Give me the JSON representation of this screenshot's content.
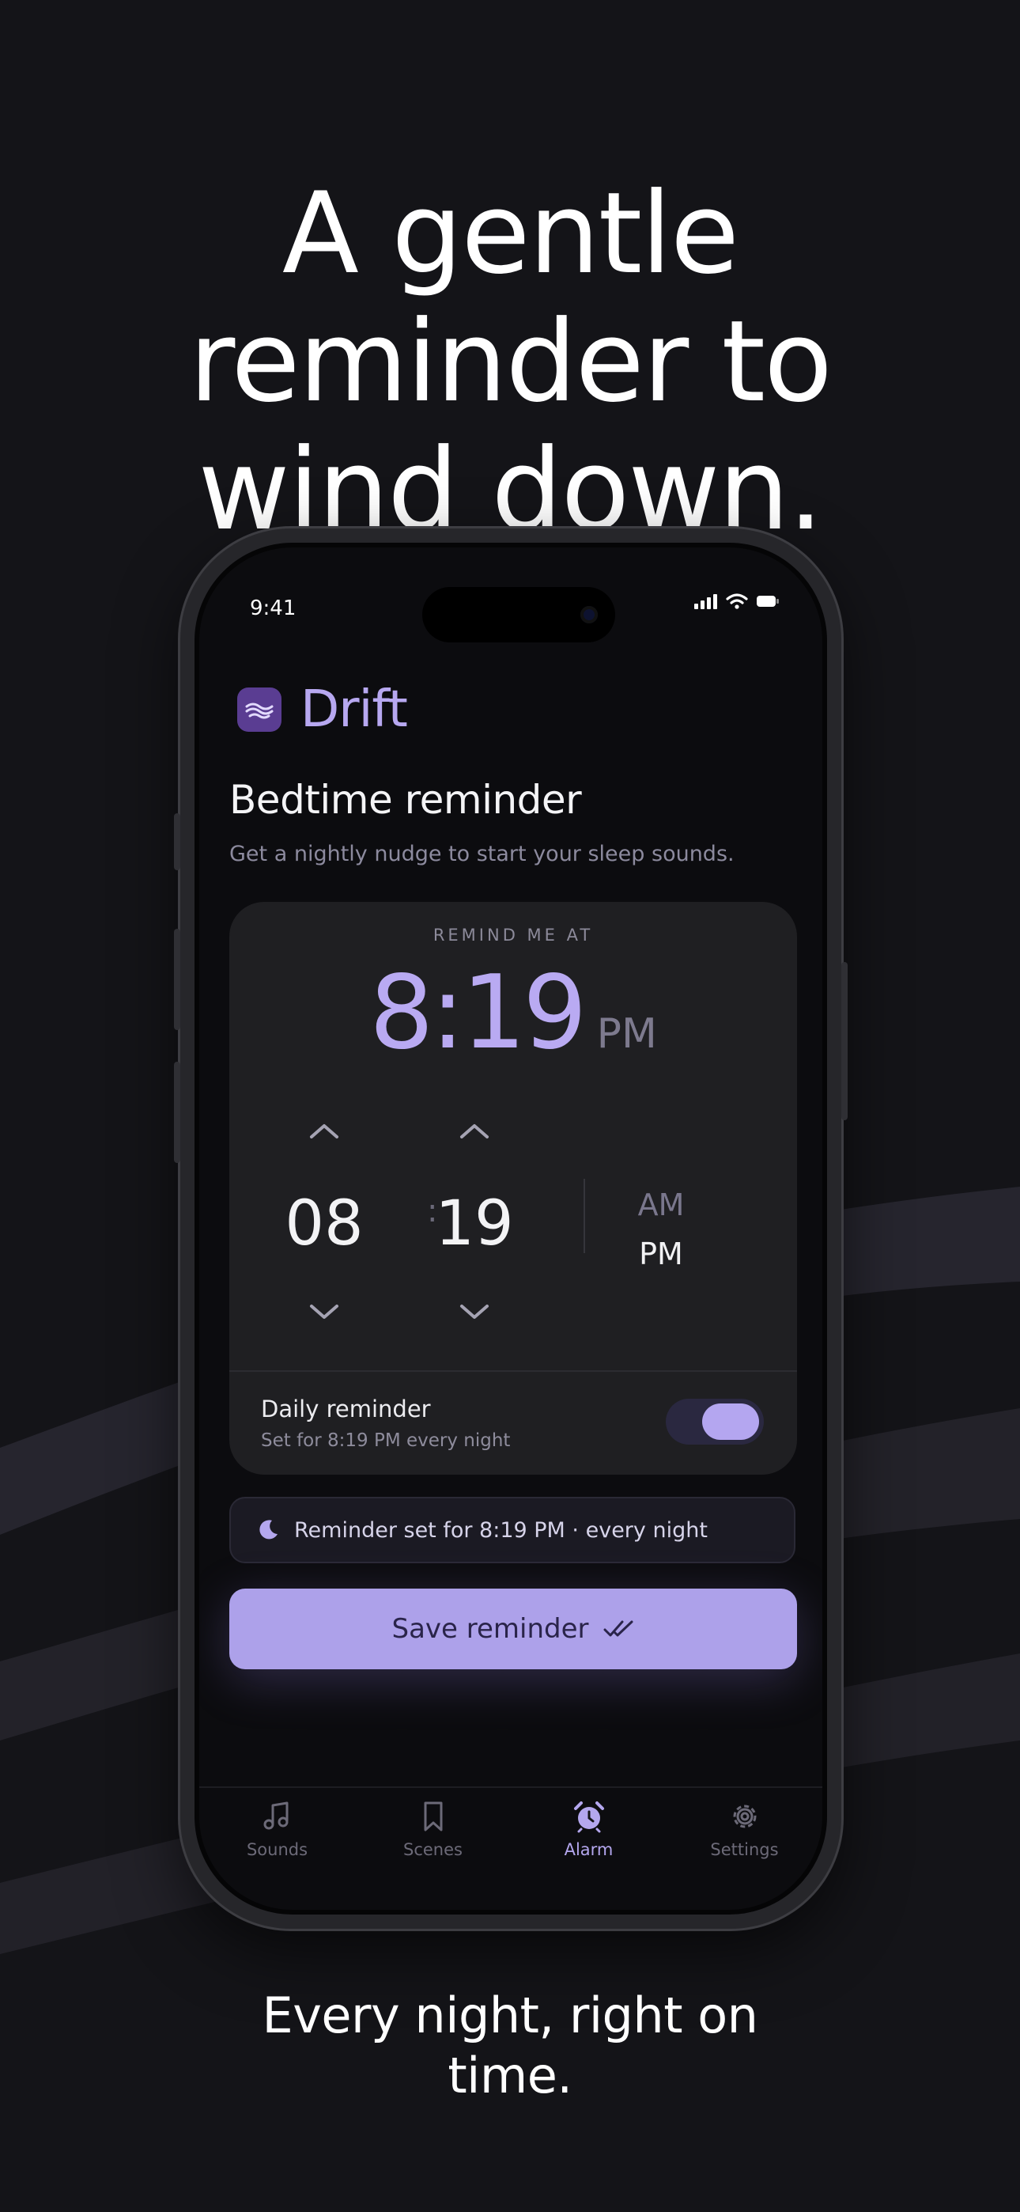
{
  "marketing": {
    "headline_lines": [
      "A gentle",
      "reminder to",
      "wind down."
    ],
    "caption_lines": [
      "Every night, right on",
      "time."
    ]
  },
  "status_bar": {
    "time": "9:41"
  },
  "app": {
    "name": "Drift"
  },
  "page": {
    "title": "Bedtime reminder",
    "subtitle": "Get a nightly nudge to start your sleep sounds."
  },
  "time_card": {
    "label": "REMIND ME AT",
    "display_time": "8:19",
    "display_period": "PM",
    "hour": "08",
    "minute": "19",
    "separator": ":",
    "period_options": [
      "AM",
      "PM"
    ],
    "selected_period": "PM"
  },
  "daily_reminder": {
    "title": "Daily reminder",
    "subtitle": "Set for 8:19 PM every night",
    "enabled": true
  },
  "banner": {
    "text": "Reminder set for 8:19 PM · every night",
    "icon": "moon-icon"
  },
  "save_button": {
    "label": "Save reminder",
    "icon": "double-check-icon"
  },
  "tabs": [
    {
      "label": "Sounds",
      "icon": "music-note-icon",
      "active": false
    },
    {
      "label": "Scenes",
      "icon": "bookmark-icon",
      "active": false
    },
    {
      "label": "Alarm",
      "icon": "alarm-clock-icon",
      "active": true
    },
    {
      "label": "Settings",
      "icon": "gear-icon",
      "active": false
    }
  ],
  "colors": {
    "background": "#141418",
    "accent": "#b4a7ee",
    "card": "#1f1f22",
    "button": "#ada1ea"
  }
}
